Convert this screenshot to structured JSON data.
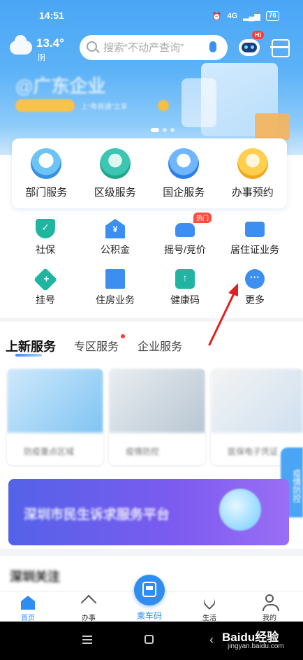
{
  "status_bar": {
    "time": "14:51",
    "network": "4G",
    "battery": "76"
  },
  "weather": {
    "temperature": "13.4°",
    "condition": "阴"
  },
  "search": {
    "placeholder": "搜索“不动产查询”"
  },
  "assistant": {
    "badge": "Hi"
  },
  "banner": {
    "title": "@广东企业",
    "subtitle": "上“粤商通”立享"
  },
  "top_services": [
    {
      "label": "部门服务",
      "icon": "department-icon"
    },
    {
      "label": "区级服务",
      "icon": "district-icon"
    },
    {
      "label": "国企服务",
      "icon": "soe-icon"
    },
    {
      "label": "办事预约",
      "icon": "appointment-icon"
    }
  ],
  "services_row1": [
    {
      "label": "社保",
      "icon": "shield-icon"
    },
    {
      "label": "公积金",
      "icon": "yen-house-icon"
    },
    {
      "label": "摇号/竞价",
      "icon": "car-icon",
      "badge": "热门"
    },
    {
      "label": "居住证业务",
      "icon": "id-card-icon"
    }
  ],
  "services_row2": [
    {
      "label": "挂号",
      "icon": "medical-plus-icon"
    },
    {
      "label": "住房业务",
      "icon": "building-icon"
    },
    {
      "label": "健康码",
      "icon": "health-code-icon"
    },
    {
      "label": "更多",
      "icon": "more-icon"
    }
  ],
  "tabs": [
    {
      "label": "上新服务",
      "active": true
    },
    {
      "label": "专区服务",
      "active": false,
      "dot": true
    },
    {
      "label": "企业服务",
      "active": false
    }
  ],
  "new_services": [
    {
      "caption": "防疫重点区域"
    },
    {
      "caption": "疫情防控"
    },
    {
      "caption": "医保电子凭证"
    }
  ],
  "side_tab": {
    "label": "疫情防控"
  },
  "promo_banner": {
    "text": "深圳市民生诉求服务平台"
  },
  "next_section": {
    "title": "深圳关注"
  },
  "bottom_nav": [
    {
      "label": "首页",
      "icon": "home-icon",
      "active": true
    },
    {
      "label": "办事",
      "icon": "send-icon",
      "active": false
    },
    {
      "label": "乘车码",
      "icon": "bus-code-icon",
      "active": false
    },
    {
      "label": "生活",
      "icon": "heart-icon",
      "active": false
    },
    {
      "label": "我的",
      "icon": "user-icon",
      "active": false
    }
  ],
  "watermark": {
    "brand": "Baidu经验",
    "url": "jingyan.baidu.com"
  },
  "colors": {
    "primary": "#2f8cf0",
    "teal": "#1fb5a0",
    "hot": "#ff4b3e",
    "annotation": "#e02020"
  }
}
